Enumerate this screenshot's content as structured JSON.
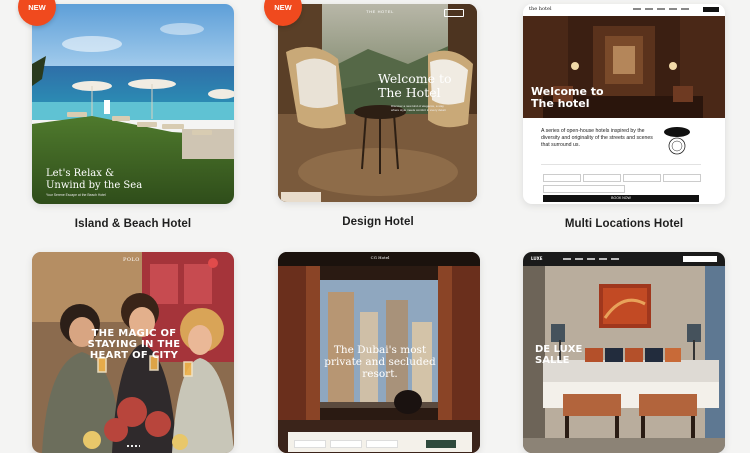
{
  "cards": [
    {
      "label": "Island & Beach Hotel",
      "badge": "NEW",
      "hero_text": "Let's Relax & Unwind by the Sea",
      "sub_text": "Your Serene Escape at the Beach Hotel"
    },
    {
      "label": "Design Hotel",
      "badge": "NEW",
      "logo": "THE HOTEL",
      "hero_text": "Welcome to The Hotel",
      "sub_text": "Discover a new kind of elegance, a stay where style meets comfort in every detail."
    },
    {
      "label": "Multi Locations Hotel",
      "logo": "the hotel",
      "hero_text": "Welcome to The hotel",
      "intro_text": "A series of open-house hotels inspired by the diversity and originality of the streets and scenes that surround us.",
      "book_button": "BOOK NOW"
    },
    {
      "logo": "POLO",
      "hero_text": "THE MAGIC OF STAYING IN THE HEART OF CITY"
    },
    {
      "logo": "CG Hotel",
      "hero_text": "The Dubai's most private and secluded resort."
    },
    {
      "logo": "LUXE",
      "hero_text": "DE LUXE SALLE"
    }
  ],
  "colors": {
    "badge": "#f04a1e",
    "background": "#f4f4f3"
  }
}
